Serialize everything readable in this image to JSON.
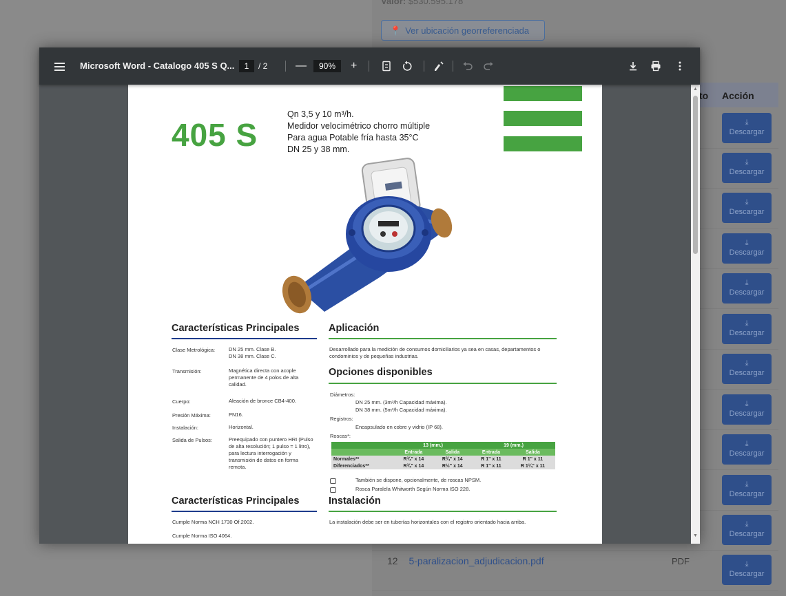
{
  "background": {
    "valor_label": "Valor:",
    "valor_value": "$530.595.178",
    "geo_button": "Ver ubicación georreferenciada",
    "table_header": {
      "col_partial": "to",
      "col_action": "Acción"
    },
    "download_label": "Descargar",
    "file_row": {
      "number": "12",
      "name": "5-paralizacion_adjudicacion.pdf",
      "type": "PDF"
    }
  },
  "viewer": {
    "title": "Microsoft Word - Catalogo 405 S Q...",
    "current_page": "1",
    "total_pages": "/ 2",
    "zoom": "90%",
    "zoom_in": "+",
    "zoom_out": "—",
    "icons": [
      "menu-icon",
      "fit-page-icon",
      "rotate-icon",
      "annotate-icon",
      "undo-icon",
      "redo-icon",
      "download-icon",
      "print-icon",
      "more-icon"
    ]
  },
  "document": {
    "model": "405 S",
    "spec_lines": [
      "Qn 3,5 y 10 m³/h.",
      "Medidor velocimétrico chorro múltiple",
      "Para agua Potable fría hasta 35°C",
      "DN 25 y 38 mm."
    ],
    "left_section_title": "Características Principales",
    "characteristics": [
      {
        "key": "Clase Metrológica:",
        "value": "DN 25 mm. Clase B.\nDN 38 mm. Clase C."
      },
      {
        "key": "Transmisión:",
        "value": "Magnética directa con acople permanente de 4 polos de alta calidad."
      },
      {
        "key": "Cuerpo:",
        "value": "Aleación de bronce CB4-400."
      },
      {
        "key": "Presión Máxima:",
        "value": "PN16."
      },
      {
        "key": "Instalación:",
        "value": "Horizontal."
      },
      {
        "key": "Salida de Pulsos:",
        "value": "Preequipado con puntero HRI (Pulso de alta resolución; 1 pulso = 1 litro), para lectura interrogación y transmisión de datos en forma remota."
      }
    ],
    "left_section_title_2": "Características Principales",
    "norms": [
      "Cumple Norma NCH 1730 Of.2002.",
      "Cumple Norma ISO 4064."
    ],
    "aplicacion_title": "Aplicación",
    "aplicacion_text": "Desarrollado para la medición de consumos domiciliarios ya sea en casas, departamentos o condominios y de pequeñas industrias.",
    "opciones_title": "Opciones disponibles",
    "diametros_label": "Diámetros:",
    "diametros": [
      "DN 25 mm. (3m³/h Capacidad máxima).",
      "DN 38 mm. (5m³/h Capacidad máxima)."
    ],
    "registros_label": "Registros:",
    "registros_value": "Encapsulado en cobre y vidrio (IP 68).",
    "roscas_label": "Roscas*:",
    "table": {
      "groups": [
        "13 (mm.)",
        "19 (mm.)"
      ],
      "subheads": [
        "Entrada",
        "Salida",
        "Entrada",
        "Salida"
      ],
      "rows": [
        {
          "label": "Normales**",
          "cells": [
            "R¾\" x 14",
            "R¾\" x 14",
            "R 1\" x 11",
            "R 1\" x 11"
          ]
        },
        {
          "label": "Diferenciados**",
          "cells": [
            "R¾\" x 14",
            "R½\" x 14",
            "R 1\" x 11",
            "R 1¼\" x 11"
          ]
        }
      ]
    },
    "notes": [
      "También se dispone, opcionalmente, de roscas NPSM.",
      "Rosca Paralela Whitworth Según Norma ISO 228."
    ],
    "instalacion_title": "Instalación",
    "instalacion_text": "La instalación debe ser en tuberías horizontales con el registro orientado hacia arriba."
  },
  "colors": {
    "brand_green": "#47a341",
    "rule_blue": "#1e3c8c",
    "viewer_bg": "#323639",
    "button_blue": "#2f4f8a"
  }
}
